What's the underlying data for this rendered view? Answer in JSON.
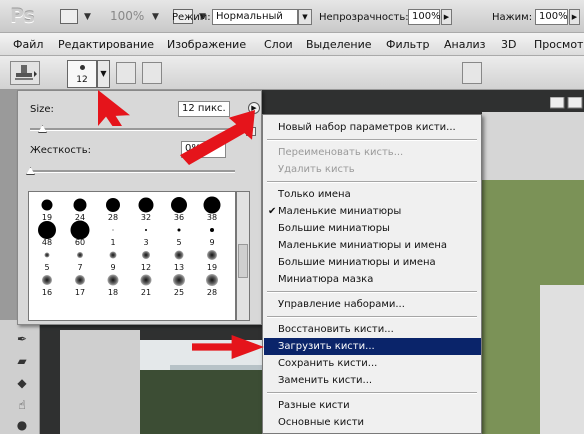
{
  "titlebar": {
    "logo": "Ps",
    "zoom": "100%",
    "caret": "▼"
  },
  "menubar": {
    "items": [
      "Файл",
      "Редактирование",
      "Изображение",
      "Слои",
      "Выделение",
      "Фильтр",
      "Анализ",
      "3D",
      "Просмотр"
    ]
  },
  "options": {
    "brush_size": "12",
    "caret": "▼",
    "mode_label": "Режим:",
    "mode_value": "Нормальный",
    "opacity_label": "Непрозрачность:",
    "opacity_value": "100%",
    "pressure_label": "Нажим:",
    "pressure_value": "100%",
    "spin": "▶"
  },
  "popup": {
    "size_label": "Size:",
    "size_value": "12 пикс.",
    "size_fraction": 0.05,
    "hardness_label": "Жесткость:",
    "hardness_value": "0%",
    "hardness_fraction": 0.0,
    "flyout": "▶",
    "brushes": [
      {
        "n": "19",
        "d": 11
      },
      {
        "n": "24",
        "d": 13
      },
      {
        "n": "28",
        "d": 14
      },
      {
        "n": "32",
        "d": 15
      },
      {
        "n": "36",
        "d": 16
      },
      {
        "n": "38",
        "d": 17
      },
      {
        "n": "48",
        "d": 18
      },
      {
        "n": "60",
        "d": 19
      },
      {
        "n": "1",
        "d": 1
      },
      {
        "n": "3",
        "d": 2
      },
      {
        "n": "5",
        "d": 3
      },
      {
        "n": "9",
        "d": 4
      },
      {
        "n": "5",
        "d": 2,
        "soft": true
      },
      {
        "n": "7",
        "d": 3,
        "soft": true
      },
      {
        "n": "9",
        "d": 4,
        "soft": true
      },
      {
        "n": "12",
        "d": 5,
        "soft": true
      },
      {
        "n": "13",
        "d": 6,
        "soft": true
      },
      {
        "n": "19",
        "d": 7,
        "soft": true
      },
      {
        "n": "16",
        "d": 7,
        "soft": true
      },
      {
        "n": "17",
        "d": 7,
        "soft": true
      },
      {
        "n": "18",
        "d": 8,
        "soft": true
      },
      {
        "n": "21",
        "d": 8,
        "soft": true
      },
      {
        "n": "25",
        "d": 9,
        "soft": true
      },
      {
        "n": "28",
        "d": 9,
        "soft": true
      }
    ]
  },
  "menu": {
    "items": [
      {
        "label": "Новый набор параметров кисти...",
        "state": "normal"
      },
      {
        "sep": true
      },
      {
        "label": "Переименовать кисть...",
        "state": "disabled"
      },
      {
        "label": "Удалить кисть",
        "state": "disabled"
      },
      {
        "sep": true
      },
      {
        "label": "Только имена",
        "state": "normal"
      },
      {
        "label": "Маленькие миниатюры",
        "state": "checked"
      },
      {
        "label": "Большие миниатюры",
        "state": "normal"
      },
      {
        "label": "Маленькие миниатюры и имена",
        "state": "normal"
      },
      {
        "label": "Большие миниатюры и имена",
        "state": "normal"
      },
      {
        "label": "Миниатюра мазка",
        "state": "normal"
      },
      {
        "sep": true
      },
      {
        "label": "Управление наборами...",
        "state": "normal"
      },
      {
        "sep": true
      },
      {
        "label": "Восстановить кисти...",
        "state": "normal"
      },
      {
        "label": "Загрузить кисти...",
        "state": "selected"
      },
      {
        "label": "Сохранить кисти...",
        "state": "normal"
      },
      {
        "label": "Заменить кисти...",
        "state": "normal"
      },
      {
        "sep": true
      },
      {
        "label": "Разные кисти",
        "state": "normal"
      },
      {
        "label": "Основные кисти",
        "state": "normal"
      }
    ],
    "check_mark": "✔"
  },
  "colors": {
    "arrow": "#e5141b",
    "selection": "#0a246a"
  }
}
